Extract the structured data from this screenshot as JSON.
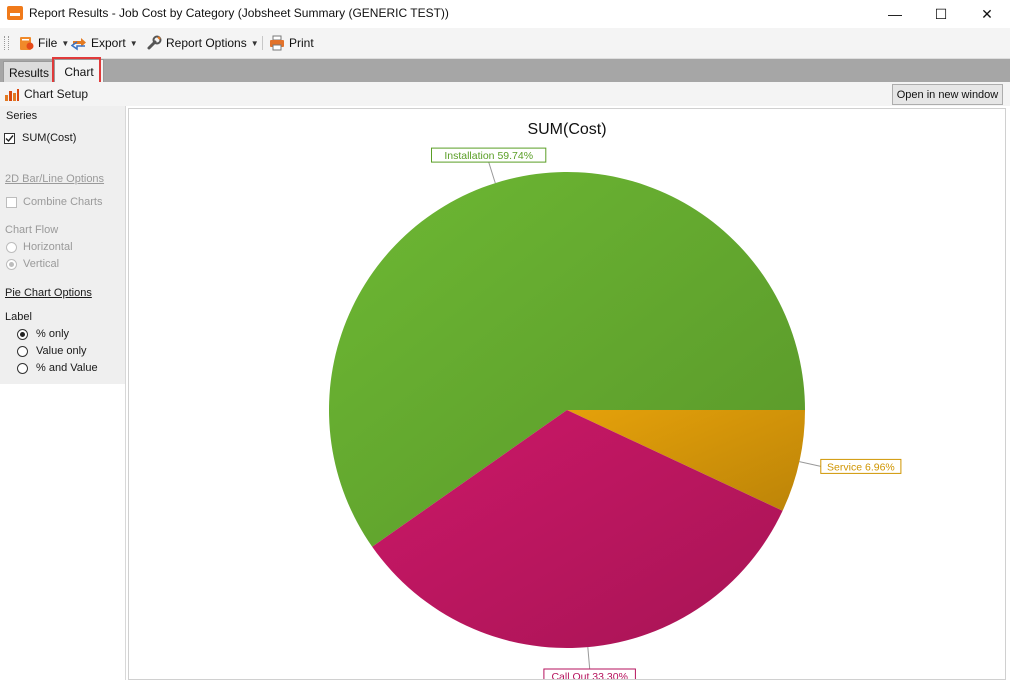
{
  "window": {
    "title": "Report Results - Job Cost by Category (Jobsheet Summary (GENERIC TEST))",
    "minimize": "—",
    "maximize": "☐",
    "close": "✕"
  },
  "toolbar": {
    "file_label": "File",
    "export_label": "Export",
    "report_options_label": "Report Options",
    "print_label": "Print"
  },
  "tabs": {
    "results": "Results",
    "chart": "Chart",
    "active": "Chart"
  },
  "chart_toolbar": {
    "chart_setup_label": "Chart Setup",
    "open_new_window_label": "Open in new window"
  },
  "left_panel": {
    "series_header": "Series",
    "series_item": {
      "label": "SUM(Cost)",
      "checked": true
    },
    "bar_line_options_label": "2D Bar/Line Options",
    "combine_charts_label": "Combine Charts",
    "chart_flow_label": "Chart Flow",
    "horizontal_label": "Horizontal",
    "vertical_label": "Vertical",
    "pie_chart_options_label": "Pie Chart Options",
    "label_header": "Label",
    "percent_only_label": "% only",
    "value_only_label": "Value only",
    "percent_and_value_label": "% and Value",
    "selected_label_option": "% only"
  },
  "chart_data": {
    "type": "pie",
    "title": "SUM(Cost)",
    "categories": [
      "Installation",
      "Service",
      "Call Out"
    ],
    "values": [
      59.74,
      6.96,
      33.3
    ],
    "labels": [
      "Installation 59.74%",
      "Service 6.96%",
      "Call Out 33.30%"
    ],
    "colors": [
      "#6db833",
      "#e5a10a",
      "#cc1868"
    ],
    "label_colors": [
      "#5a9e26",
      "#d09500",
      "#b5125c"
    ]
  }
}
